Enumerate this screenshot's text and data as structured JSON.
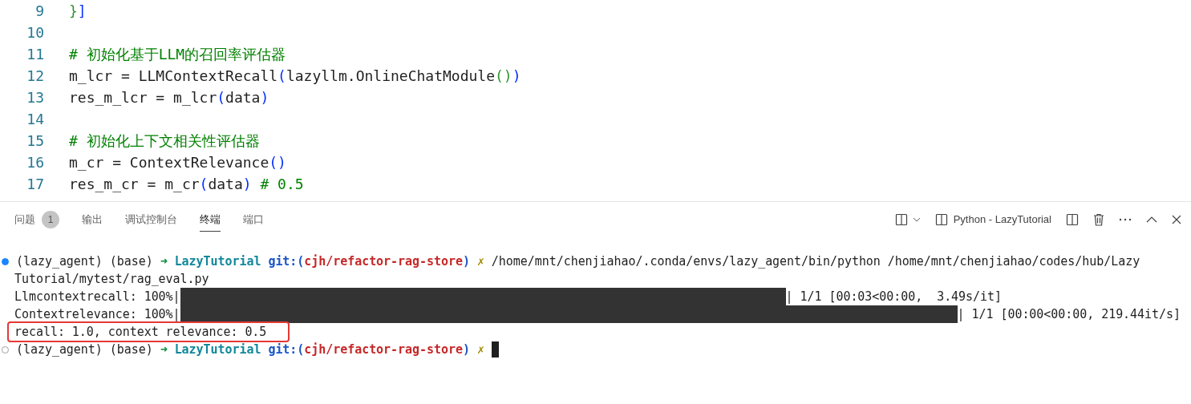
{
  "editor": {
    "lines": [
      {
        "number": "9",
        "tokens": [
          {
            "kind": "bracket_green",
            "text": "}"
          },
          {
            "kind": "bracket_blue",
            "text": "]"
          }
        ]
      },
      {
        "number": "10"
      },
      {
        "number": "11",
        "tokens": [
          {
            "kind": "comment",
            "text": "# 初始化基于LLM的召回率评估器"
          }
        ]
      },
      {
        "number": "12",
        "tokens": [
          {
            "kind": "text",
            "text": "m_lcr = LLMContextRecall"
          },
          {
            "kind": "bracket_blue",
            "text": "("
          },
          {
            "kind": "text",
            "text": "lazyllm.OnlineChatModule"
          },
          {
            "kind": "bracket_green",
            "text": "()"
          },
          {
            "kind": "bracket_blue",
            "text": ")"
          }
        ]
      },
      {
        "number": "13",
        "tokens": [
          {
            "kind": "text",
            "text": "res_m_lcr = m_lcr"
          },
          {
            "kind": "bracket_blue",
            "text": "("
          },
          {
            "kind": "text",
            "text": "data"
          },
          {
            "kind": "bracket_blue",
            "text": ")"
          }
        ]
      },
      {
        "number": "14"
      },
      {
        "number": "15",
        "tokens": [
          {
            "kind": "comment",
            "text": "# 初始化上下文相关性评估器"
          }
        ]
      },
      {
        "number": "16",
        "tokens": [
          {
            "kind": "text",
            "text": "m_cr = ContextRelevance"
          },
          {
            "kind": "bracket_blue",
            "text": "()"
          }
        ]
      },
      {
        "number": "17",
        "tokens": [
          {
            "kind": "text",
            "text": "res_m_cr = m_cr"
          },
          {
            "kind": "bracket_blue",
            "text": "("
          },
          {
            "kind": "text",
            "text": "data"
          },
          {
            "kind": "bracket_blue",
            "text": ")"
          },
          {
            "kind": "comment",
            "text": " # 0.5"
          }
        ]
      }
    ]
  },
  "panel": {
    "tabs": [
      {
        "label": "问题",
        "badge": "1",
        "selected": false
      },
      {
        "label": "输出",
        "selected": false
      },
      {
        "label": "调试控制台",
        "selected": false
      },
      {
        "label": "终端",
        "selected": true
      },
      {
        "label": "端口",
        "selected": false
      }
    ],
    "terminal_name": "Python - LazyTutorial"
  },
  "terminal": {
    "lines": [
      {
        "kind": "prompt",
        "active": true,
        "env": "(lazy_agent) (base)",
        "arrow": "➜",
        "dir": "LazyTutorial",
        "git_open": "git:(",
        "branch": "cjh/refactor-rag-store",
        "git_close": ")",
        "dirty": "✗",
        "command": "/home/mnt/chenjiahao/.conda/envs/lazy_agent/bin/python /home/mnt/chenjiahao/codes/hub/Lazy"
      },
      {
        "kind": "output",
        "text": "Tutorial/mytest/rag_eval.py",
        "highlighted": false
      },
      {
        "kind": "progress",
        "label": "Llmcontextrecall: 100%|",
        "stats": "| 1/1 [00:03<00:00,  3.49s/it]"
      },
      {
        "kind": "progress",
        "label": "Contextrelevance: 100%|",
        "stats": "| 1/1 [00:00<00:00, 219.44it/s]"
      },
      {
        "kind": "output",
        "text": "recall: 1.0, context relevance: 0.5",
        "highlighted": true
      },
      {
        "kind": "prompt",
        "active": false,
        "env": "(lazy_agent) (base)",
        "arrow": "➜",
        "dir": "LazyTutorial",
        "git_open": "git:(",
        "branch": "cjh/refactor-rag-store",
        "git_close": ")",
        "dirty": "✗",
        "cursor": true
      }
    ]
  }
}
